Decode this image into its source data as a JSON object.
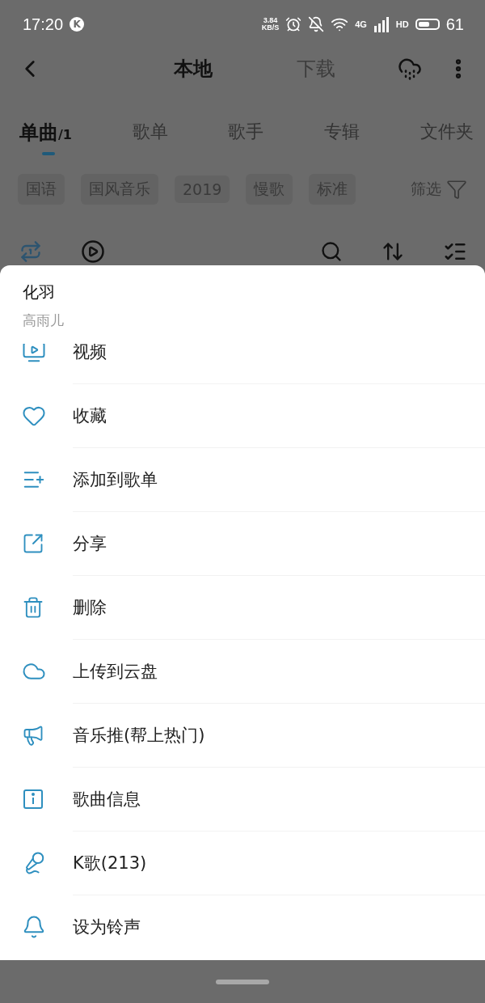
{
  "status_bar": {
    "time": "17:20",
    "app_badge": "K",
    "speed_value": "3.84",
    "speed_unit": "KB/S",
    "network": "4G",
    "hd": "HD",
    "battery": "61"
  },
  "header": {
    "tabs": [
      {
        "label": "本地",
        "selected": true
      },
      {
        "label": "下载",
        "selected": false
      }
    ]
  },
  "category_tabs": [
    {
      "label": "单曲",
      "count": "/1",
      "selected": true
    },
    {
      "label": "歌单",
      "selected": false
    },
    {
      "label": "歌手",
      "selected": false
    },
    {
      "label": "专辑",
      "selected": false
    },
    {
      "label": "文件夹",
      "selected": false
    }
  ],
  "filter_chips": [
    "国语",
    "国风音乐",
    "2019",
    "慢歌",
    "标准"
  ],
  "filter_button": "筛选",
  "sheet": {
    "song_title": "化羽",
    "artist": "高雨儿",
    "items": [
      "视频",
      "收藏",
      "添加到歌单",
      "分享",
      "删除",
      "上传到云盘",
      "音乐推(帮上热门)",
      "歌曲信息",
      "K歌(213)",
      "设为铃声"
    ]
  }
}
